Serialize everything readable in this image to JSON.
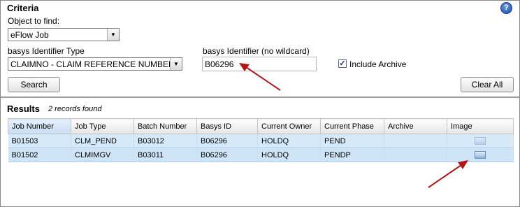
{
  "criteria": {
    "title": "Criteria",
    "help_glyph": "?",
    "object_label": "Object to find:",
    "object_value": "eFlow Job",
    "id_type_label": "basys Identifier Type",
    "id_type_value": "CLAIMNO - CLAIM REFERENCE NUMBER",
    "identifier_label": "basys Identifier (no wildcard)",
    "identifier_value": "B06296",
    "include_archive_label": "Include Archive",
    "include_archive_checked": true,
    "check_glyph": "✓",
    "search_button": "Search",
    "clear_button": "Clear All"
  },
  "results": {
    "title": "Results",
    "count_text": "2 records found",
    "columns": [
      "Job Number",
      "Job Type",
      "Batch Number",
      "Basys ID",
      "Current Owner",
      "Current Phase",
      "Archive",
      "Image"
    ],
    "rows": [
      {
        "job_number": "B01503",
        "job_type": "CLM_PEND",
        "batch_number": "B03012",
        "basys_id": "B06296",
        "current_owner": "HOLDQ",
        "current_phase": "PEND",
        "archive": "",
        "image": "image-icon"
      },
      {
        "job_number": "B01502",
        "job_type": "CLMIMGV",
        "batch_number": "B03011",
        "basys_id": "B06296",
        "current_owner": "HOLDQ",
        "current_phase": "PENDP",
        "archive": "",
        "image": "image-icon"
      }
    ]
  },
  "colors": {
    "arrow": "#b01818",
    "row_selected": "#d6e9f9",
    "header_sorted": "#c9dcf3"
  }
}
